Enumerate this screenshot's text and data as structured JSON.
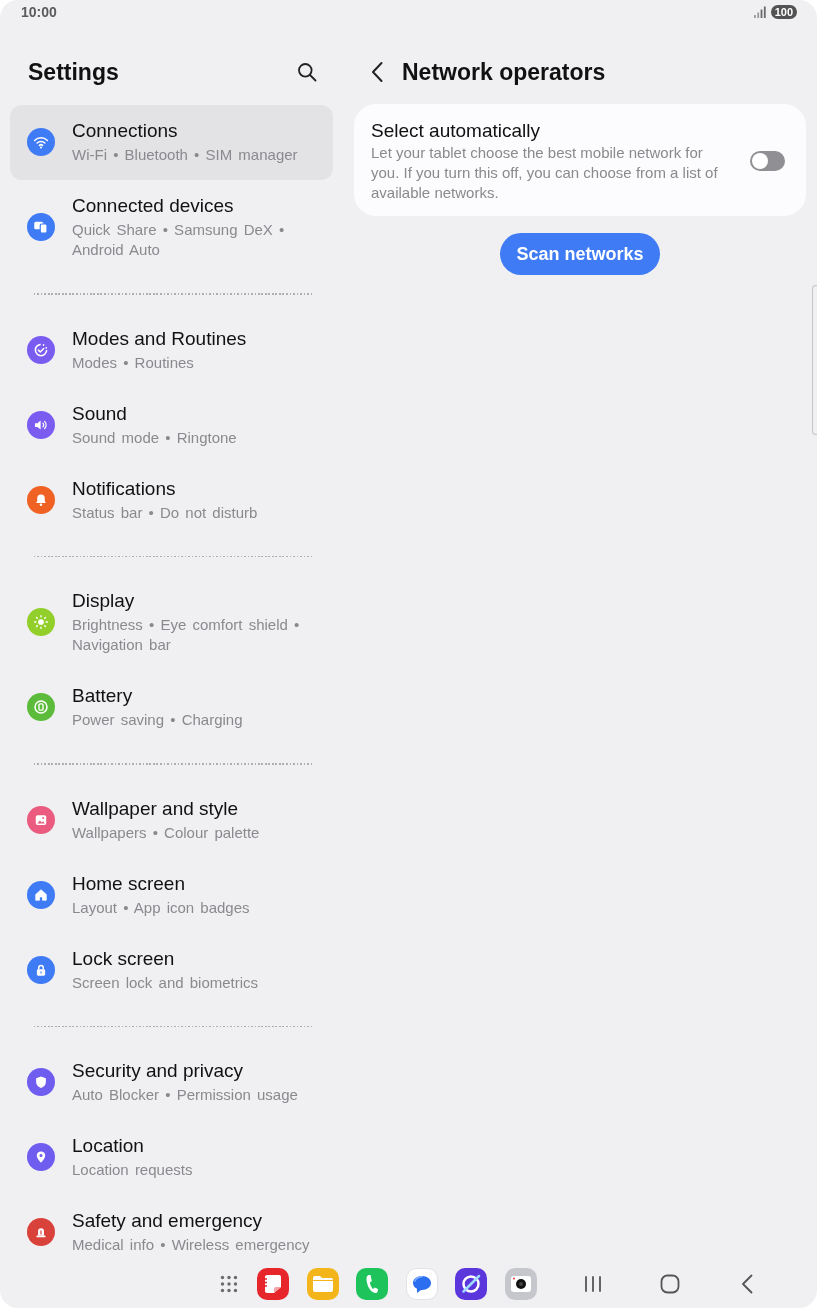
{
  "status_bar": {
    "time": "10:00",
    "battery": "100"
  },
  "sidebar": {
    "title": "Settings",
    "groups": [
      {
        "items": [
          {
            "title": "Connections",
            "subtitle": "Wi-Fi • Bluetooth • SIM manager",
            "color": "#3e7bf4",
            "selected": true
          },
          {
            "title": "Connected devices",
            "subtitle": "Quick Share • Samsung DeX • Android Auto",
            "color": "#3e7bf4",
            "selected": false
          }
        ]
      },
      {
        "items": [
          {
            "title": "Modes and Routines",
            "subtitle": "Modes • Routines",
            "color": "#7a5cf0",
            "selected": false
          },
          {
            "title": "Sound",
            "subtitle": "Sound mode • Ringtone",
            "color": "#7a5cf0",
            "selected": false
          },
          {
            "title": "Notifications",
            "subtitle": "Status bar • Do not disturb",
            "color": "#ef6223",
            "selected": false
          }
        ]
      },
      {
        "items": [
          {
            "title": "Display",
            "subtitle": "Brightness • Eye comfort shield • Navigation bar",
            "color": "#93cf2b",
            "selected": false
          },
          {
            "title": "Battery",
            "subtitle": "Power saving • Charging",
            "color": "#5cbb3b",
            "selected": false
          }
        ]
      },
      {
        "items": [
          {
            "title": "Wallpaper and style",
            "subtitle": "Wallpapers • Colour palette",
            "color": "#ea5b7f",
            "selected": false
          },
          {
            "title": "Home screen",
            "subtitle": "Layout • App icon badges",
            "color": "#3e7bf4",
            "selected": false
          },
          {
            "title": "Lock screen",
            "subtitle": "Screen lock and biometrics",
            "color": "#3e7bf4",
            "selected": false
          }
        ]
      },
      {
        "items": [
          {
            "title": "Security and privacy",
            "subtitle": "Auto Blocker • Permission usage",
            "color": "#6f5df0",
            "selected": false
          },
          {
            "title": "Location",
            "subtitle": "Location requests",
            "color": "#6f5df0",
            "selected": false
          },
          {
            "title": "Safety and emergency",
            "subtitle": "Medical info • Wireless emergency",
            "color": "#d8423b",
            "selected": false
          }
        ]
      }
    ]
  },
  "page": {
    "title": "Network operators",
    "setting": {
      "title": "Select automatically",
      "description": "Let your tablet choose the best mobile network for you. If you turn this off, you can choose from a list of available networks.",
      "on": false
    },
    "button": "Scan networks"
  }
}
